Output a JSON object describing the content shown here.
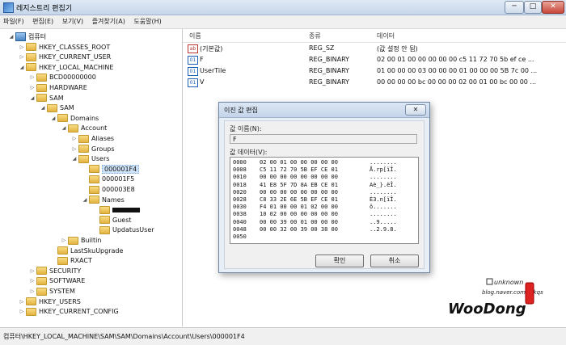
{
  "window": {
    "title": "레지스트리 편집기",
    "controls": [
      "─",
      "□",
      "✕"
    ]
  },
  "menu": [
    "파일(F)",
    "편집(E)",
    "보기(V)",
    "즐겨찾기(A)",
    "도움말(H)"
  ],
  "tree": [
    {
      "label": "컴퓨터",
      "level": 0,
      "expander": "◢",
      "icon": "pc"
    },
    {
      "label": "HKEY_CLASSES_ROOT",
      "level": 1,
      "expander": "▷",
      "icon": "folder"
    },
    {
      "label": "HKEY_CURRENT_USER",
      "level": 1,
      "expander": "▷",
      "icon": "folder"
    },
    {
      "label": "HKEY_LOCAL_MACHINE",
      "level": 1,
      "expander": "◢",
      "icon": "folder"
    },
    {
      "label": "BCD00000000",
      "level": 2,
      "expander": "▷",
      "icon": "folder"
    },
    {
      "label": "HARDWARE",
      "level": 2,
      "expander": "▷",
      "icon": "folder"
    },
    {
      "label": "SAM",
      "level": 2,
      "expander": "◢",
      "icon": "folder"
    },
    {
      "label": "SAM",
      "level": 3,
      "expander": "◢",
      "icon": "folder"
    },
    {
      "label": "Domains",
      "level": 4,
      "expander": "◢",
      "icon": "folder"
    },
    {
      "label": "Account",
      "level": 5,
      "expander": "◢",
      "icon": "folder"
    },
    {
      "label": "Aliases",
      "level": 6,
      "expander": "▷",
      "icon": "folder"
    },
    {
      "label": "Groups",
      "level": 6,
      "expander": "▷",
      "icon": "folder"
    },
    {
      "label": "Users",
      "level": 6,
      "expander": "◢",
      "icon": "folder"
    },
    {
      "label": "000001F4",
      "level": 7,
      "expander": "",
      "icon": "folder",
      "selected": true
    },
    {
      "label": "000001F5",
      "level": 7,
      "expander": "",
      "icon": "folder"
    },
    {
      "label": "000003E8",
      "level": 7,
      "expander": "",
      "icon": "folder"
    },
    {
      "label": "Names",
      "level": 7,
      "expander": "◢",
      "icon": "folder"
    },
    {
      "label": "",
      "level": 8,
      "expander": "",
      "icon": "folder",
      "redacted": true
    },
    {
      "label": "Guest",
      "level": 8,
      "expander": "",
      "icon": "folder"
    },
    {
      "label": "UpdatusUser",
      "level": 8,
      "expander": "",
      "icon": "folder"
    },
    {
      "label": "Builtin",
      "level": 5,
      "expander": "▷",
      "icon": "folder"
    },
    {
      "label": "LastSkuUpgrade",
      "level": 4,
      "expander": "",
      "icon": "folder"
    },
    {
      "label": "RXACT",
      "level": 4,
      "expander": "",
      "icon": "folder"
    },
    {
      "label": "SECURITY",
      "level": 2,
      "expander": "▷",
      "icon": "folder"
    },
    {
      "label": "SOFTWARE",
      "level": 2,
      "expander": "▷",
      "icon": "folder"
    },
    {
      "label": "SYSTEM",
      "level": 2,
      "expander": "▷",
      "icon": "folder"
    },
    {
      "label": "HKEY_USERS",
      "level": 1,
      "expander": "▷",
      "icon": "folder"
    },
    {
      "label": "HKEY_CURRENT_CONFIG",
      "level": 1,
      "expander": "▷",
      "icon": "folder"
    }
  ],
  "values": {
    "columns": [
      "이름",
      "종류",
      "데이터"
    ],
    "rows": [
      {
        "icon": "ab",
        "name": "(기본값)",
        "type": "REG_SZ",
        "data": "(값 설정 안 됨)"
      },
      {
        "icon": "bin",
        "name": "F",
        "type": "REG_BINARY",
        "data": "02 00 01 00 00 00 00 00 c5 11 72 70 5b ef ce ..."
      },
      {
        "icon": "bin",
        "name": "UserTile",
        "type": "REG_BINARY",
        "data": "01 00 00 00 03 00 00 00 01 00 00 00 5B 7c 00 ..."
      },
      {
        "icon": "bin",
        "name": "V",
        "type": "REG_BINARY",
        "data": "00 00 00 00 bc 00 00 00 02 00 01 00 bc 00 00 ..."
      }
    ]
  },
  "statusbar": "컴퓨터\\HKEY_LOCAL_MACHINE\\SAM\\SAM\\Domains\\Account\\Users\\000001F4",
  "dialog": {
    "title": "이진 값 편집",
    "close": "✕",
    "name_label": "값 이름(N):",
    "name_value": "F",
    "data_label": "값 데이터(V):",
    "hex": [
      {
        "addr": "0000",
        "bytes": "02 00 01 00 00 00 00 00",
        "ascii": "........"
      },
      {
        "addr": "0008",
        "bytes": "C5 11 72 70 5B EF CE 01",
        "ascii": "Å.rp[ïÎ."
      },
      {
        "addr": "0010",
        "bytes": "00 00 00 00 00 00 00 00",
        "ascii": "........"
      },
      {
        "addr": "0018",
        "bytes": "41 E8 5F 7D 8A EB CE 01",
        "ascii": "Aè_}.ëÎ."
      },
      {
        "addr": "0020",
        "bytes": "00 00 00 00 00 00 00 00",
        "ascii": "........"
      },
      {
        "addr": "0028",
        "bytes": "C8 33 2E 6E 5B EF CE 01",
        "ascii": "È3.n[ïÎ."
      },
      {
        "addr": "0030",
        "bytes": "F4 01 00 00 01 02 00 00",
        "ascii": "ô......."
      },
      {
        "addr": "0038",
        "bytes": "10 02 00 00 00 00 00 00",
        "ascii": "........"
      },
      {
        "addr": "0040",
        "bytes": "00 00 39 00 01 00 00 00",
        "ascii": "..9....."
      },
      {
        "addr": "0048",
        "bytes": "00 00 32 00 39 00 38 00",
        "ascii": "..2.9.8."
      },
      {
        "addr": "0050",
        "bytes": "",
        "ascii": ""
      }
    ],
    "ok": "확인",
    "cancel": "취소"
  },
  "watermark": {
    "small": "unknown",
    "blog": "blog.naver.com/szkqs",
    "big": "WooDong"
  }
}
